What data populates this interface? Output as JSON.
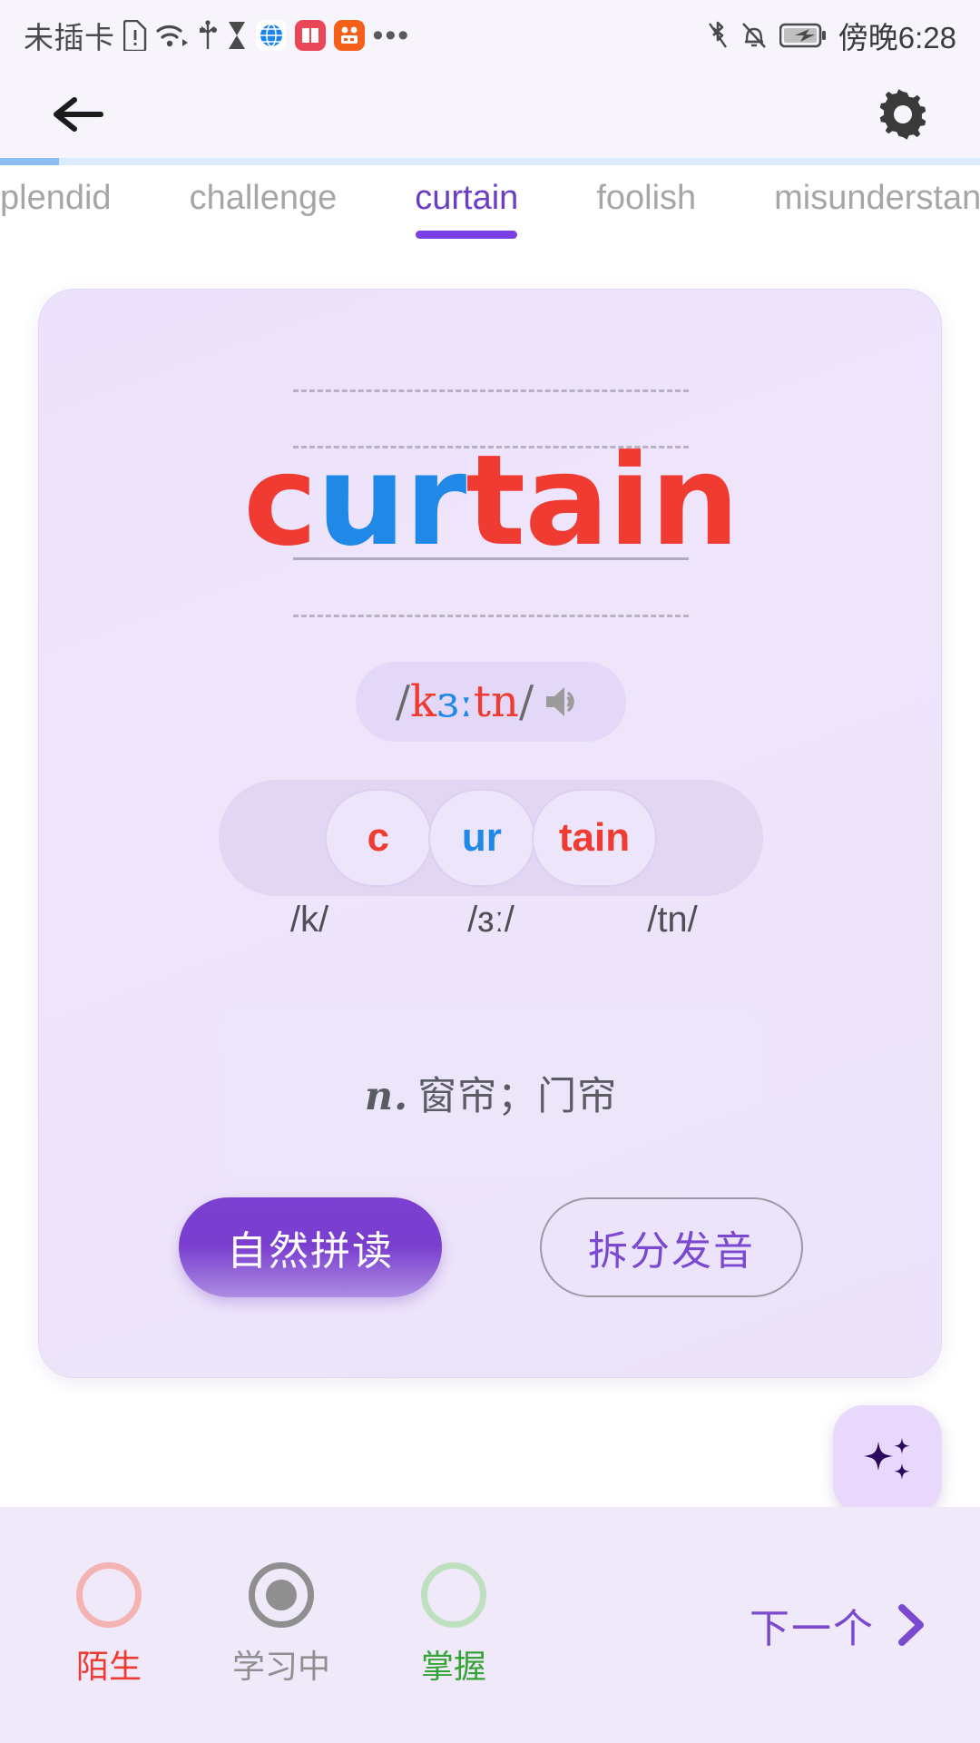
{
  "status_bar": {
    "carrier": "未插卡",
    "time": "傍晚6:28",
    "left_icons": [
      "sim-alert-icon",
      "wifi-icon",
      "usb-icon",
      "hourglass-icon",
      "globe-app-icon",
      "book-app-icon",
      "orange-app-icon",
      "overflow-dots-icon"
    ],
    "right_icons": [
      "bluetooth-icon",
      "notifications-muted-icon",
      "battery-charging-icon"
    ]
  },
  "app_bar": {
    "back_icon": "back-arrow-icon",
    "settings_icon": "gear-icon"
  },
  "progress": {
    "percent": 6,
    "fill_color": "#8cbdf2",
    "track_color": "#dcebfb"
  },
  "tabs": {
    "items": [
      {
        "label": "splendid",
        "active": false
      },
      {
        "label": "challenge",
        "active": false
      },
      {
        "label": "curtain",
        "active": true
      },
      {
        "label": "foolish",
        "active": false
      },
      {
        "label": "misunderstand",
        "active": false
      }
    ],
    "active_color": "#6b3fc4",
    "inactive_color": "#a6a6a6"
  },
  "card": {
    "word": {
      "full": "curtain",
      "parts": [
        {
          "text": "c",
          "color": "#ef3b32"
        },
        {
          "text": "ur",
          "color": "#2089e8"
        },
        {
          "text": "t",
          "color": "#ef3b32"
        },
        {
          "text": "ai",
          "color": "#ef3b32"
        },
        {
          "text": "n",
          "color": "#ef3b32"
        }
      ]
    },
    "phonetic": {
      "open_slash": "/",
      "close_slash": "/",
      "segments": [
        {
          "text": "k",
          "color": "#ef3b32"
        },
        {
          "text": "ɜː",
          "color": "#2089e8"
        },
        {
          "text": "tn",
          "color": "#ef3b32"
        }
      ],
      "speaker_icon": "speaker-icon"
    },
    "syllables": [
      {
        "text": "c",
        "color": "#ef3b32",
        "phonetic": "/k/"
      },
      {
        "text": "ur",
        "color": "#2089e8",
        "phonetic": "/ɜː/"
      },
      {
        "text": "tain",
        "color": "#ef3b32",
        "phonetic": "/tn/"
      }
    ],
    "definition": {
      "pos": "n.",
      "meaning": "窗帘；门帘"
    },
    "actions": {
      "primary_label": "自然拼读",
      "secondary_label": "拆分发音"
    }
  },
  "fab": {
    "icon": "sparkles-icon"
  },
  "bottom_bar": {
    "statuses": [
      {
        "label": "陌生",
        "state": "unfamiliar",
        "selected": false,
        "color": "#ef3b32"
      },
      {
        "label": "学习中",
        "state": "learning",
        "selected": true,
        "color": "#8f8f8f"
      },
      {
        "label": "掌握",
        "state": "mastered",
        "selected": false,
        "color": "#36a336"
      }
    ],
    "next_label": "下一个",
    "next_icon": "chevron-right-icon"
  }
}
